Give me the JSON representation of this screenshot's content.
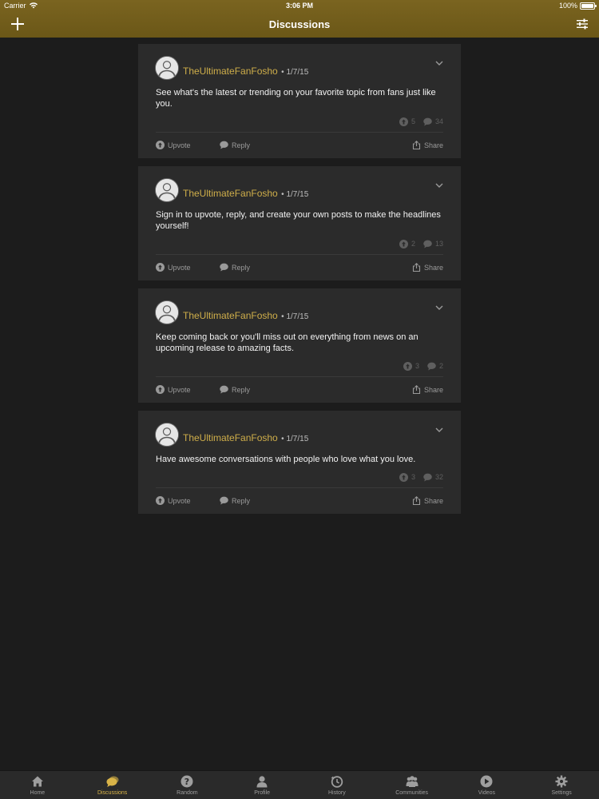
{
  "status": {
    "carrier": "Carrier",
    "time": "3:06 PM",
    "battery": "100%"
  },
  "nav": {
    "title": "Discussions"
  },
  "colors": {
    "accent": "#cfae4a",
    "bar": "#6b5717",
    "card": "#2b2b2b",
    "background": "#1c1c1c"
  },
  "posts": [
    {
      "username": "TheUltimateFanFosho",
      "date": "• 1/7/15",
      "text": "See what's the latest or trending on your favorite topic from fans just like you.",
      "upvotes": "5",
      "replies": "34",
      "upvote_label": "Upvote",
      "reply_label": "Reply",
      "share_label": "Share"
    },
    {
      "username": "TheUltimateFanFosho",
      "date": "• 1/7/15",
      "text": "Sign in to upvote, reply, and create your own posts to make the headlines yourself!",
      "upvotes": "2",
      "replies": "13",
      "upvote_label": "Upvote",
      "reply_label": "Reply",
      "share_label": "Share"
    },
    {
      "username": "TheUltimateFanFosho",
      "date": "• 1/7/15",
      "text": "Keep coming back or you'll miss out on everything from news on an upcoming release to amazing facts.",
      "upvotes": "3",
      "replies": "2",
      "upvote_label": "Upvote",
      "reply_label": "Reply",
      "share_label": "Share"
    },
    {
      "username": "TheUltimateFanFosho",
      "date": "• 1/7/15",
      "text": "Have awesome conversations with people who love what you love.",
      "upvotes": "3",
      "replies": "32",
      "upvote_label": "Upvote",
      "reply_label": "Reply",
      "share_label": "Share"
    }
  ],
  "tabs": [
    {
      "label": "Home",
      "icon": "home-icon"
    },
    {
      "label": "Discussions",
      "icon": "discussions-icon"
    },
    {
      "label": "Random",
      "icon": "question-icon"
    },
    {
      "label": "Profile",
      "icon": "profile-icon"
    },
    {
      "label": "History",
      "icon": "history-icon"
    },
    {
      "label": "Communities",
      "icon": "communities-icon"
    },
    {
      "label": "Videos",
      "icon": "play-icon"
    },
    {
      "label": "Settings",
      "icon": "gear-icon"
    }
  ]
}
